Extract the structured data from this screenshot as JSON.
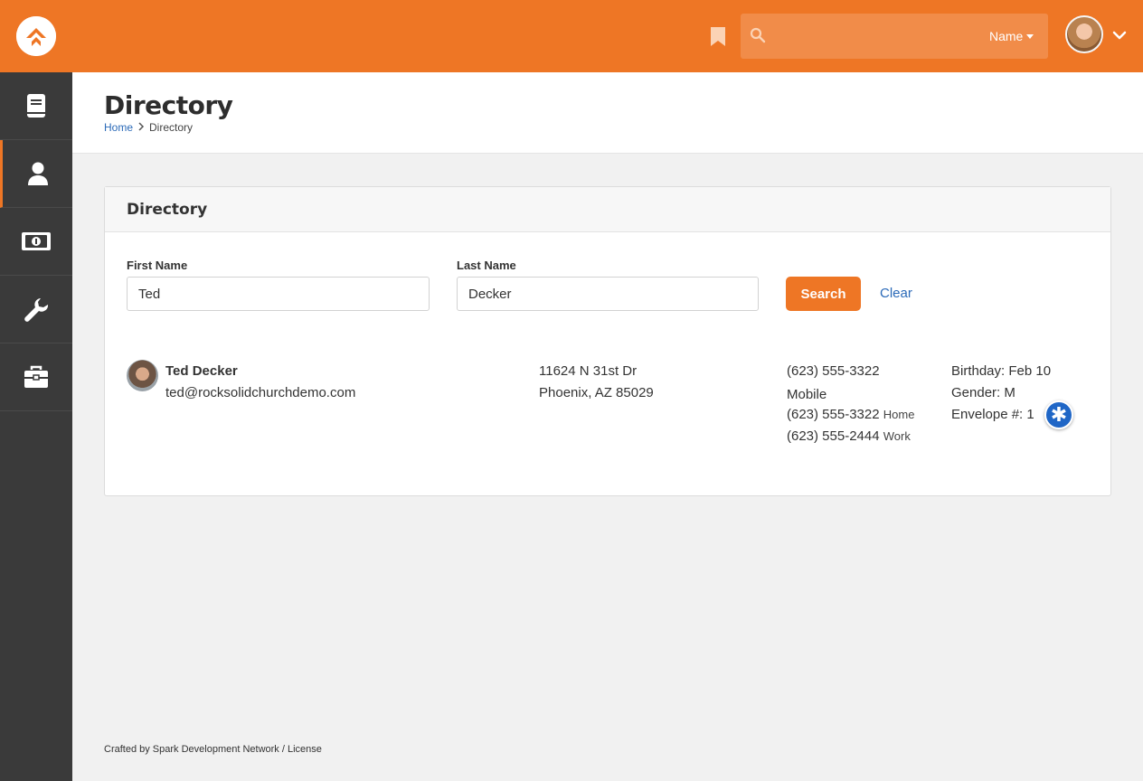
{
  "topbar": {
    "search_placeholder": "",
    "search_filter": "Name",
    "logo_icon": "rock-logo-icon",
    "bookmark_icon": "bookmark-icon",
    "search_icon": "search-icon",
    "accent_color": "#ee7625"
  },
  "sidebar": {
    "items": [
      {
        "icon": "book-icon",
        "active": false
      },
      {
        "icon": "person-icon",
        "active": true
      },
      {
        "icon": "money-icon",
        "active": false
      },
      {
        "icon": "wrench-icon",
        "active": false
      },
      {
        "icon": "briefcase-icon",
        "active": false
      }
    ]
  },
  "page": {
    "title": "Directory",
    "breadcrumb": {
      "home": "Home",
      "current": "Directory"
    }
  },
  "panel": {
    "title": "Directory",
    "first_name_label": "First Name",
    "first_name_value": "Ted",
    "last_name_label": "Last Name",
    "last_name_value": "Decker",
    "search_button": "Search",
    "clear_link": "Clear"
  },
  "result": {
    "name": "Ted Decker",
    "email": "ted@rocksolidchurchdemo.com",
    "address_line1": "11624 N 31st Dr",
    "address_line2": "Phoenix, AZ 85029",
    "phones": [
      {
        "number": "(623) 555-3322",
        "type": "Mobile"
      },
      {
        "number": "(623) 555-3322",
        "type": "Home"
      },
      {
        "number": "(623) 555-2444",
        "type": "Work"
      }
    ],
    "birthday": "Birthday: Feb 10",
    "gender": "Gender: M",
    "envelope": "Envelope #: 1",
    "badge_glyph": "✱"
  },
  "footer": {
    "crafted": "Crafted by Spark Development Network",
    "separator": " / ",
    "license": "License"
  }
}
